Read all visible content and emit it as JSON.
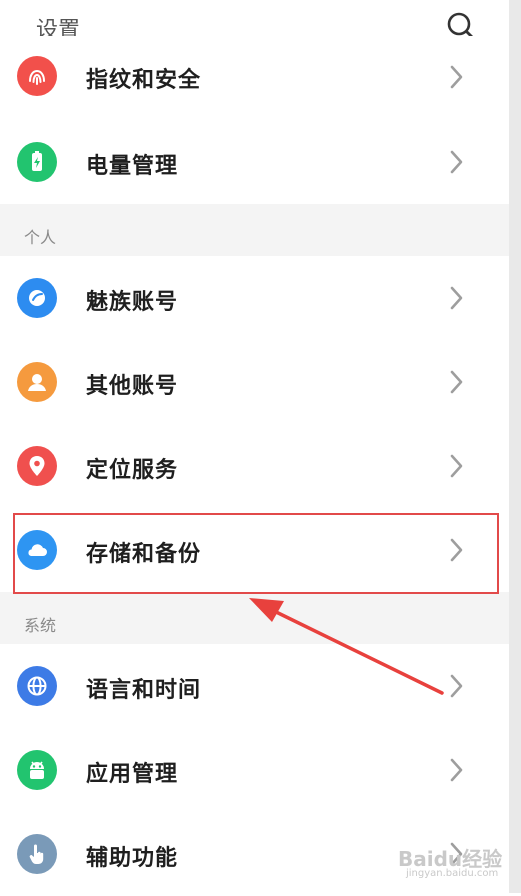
{
  "header": {
    "title": "设置"
  },
  "items_top": [
    {
      "label": "指纹和安全",
      "color": "#f2504b",
      "icon": "fingerprint-icon"
    },
    {
      "label": "电量管理",
      "color": "#22c46f",
      "icon": "battery-icon"
    }
  ],
  "section_personal": {
    "title": "个人"
  },
  "items_personal": [
    {
      "label": "魅族账号",
      "color": "#2d8cf0",
      "icon": "meizu-account-icon"
    },
    {
      "label": "其他账号",
      "color": "#f59a3e",
      "icon": "person-icon"
    },
    {
      "label": "定位服务",
      "color": "#f0504e",
      "icon": "location-pin-icon"
    },
    {
      "label": "存储和备份",
      "color": "#2e95f2",
      "icon": "cloud-icon"
    }
  ],
  "section_system": {
    "title": "系统"
  },
  "items_system": [
    {
      "label": "语言和时间",
      "color": "#3d7be6",
      "icon": "globe-icon"
    },
    {
      "label": "应用管理",
      "color": "#22c46f",
      "icon": "android-icon"
    },
    {
      "label": "辅助功能",
      "color": "#7a9ab8",
      "icon": "hand-icon"
    }
  ],
  "watermark": {
    "main": "Baidu经验",
    "sub": "jingyan.baidu.com"
  }
}
